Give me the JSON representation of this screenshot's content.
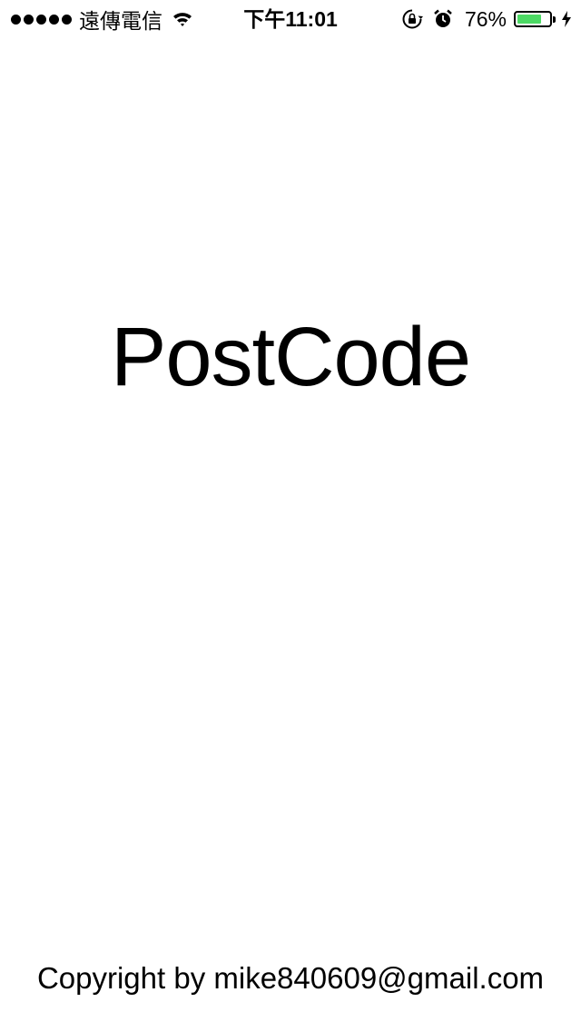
{
  "status_bar": {
    "signal_bars": 5,
    "carrier": "遠傳電信",
    "time": "下午11:01",
    "battery_percent": "76%",
    "battery_level": 0.76,
    "battery_color": "#4cd964",
    "icons": [
      "signal-dots-icon",
      "wifi-icon",
      "orientation-lock-icon",
      "alarm-icon",
      "battery-icon",
      "charging-bolt-icon"
    ]
  },
  "main": {
    "title": "PostCode"
  },
  "footer": {
    "copyright": "Copyright by mike840609@gmail.com"
  }
}
